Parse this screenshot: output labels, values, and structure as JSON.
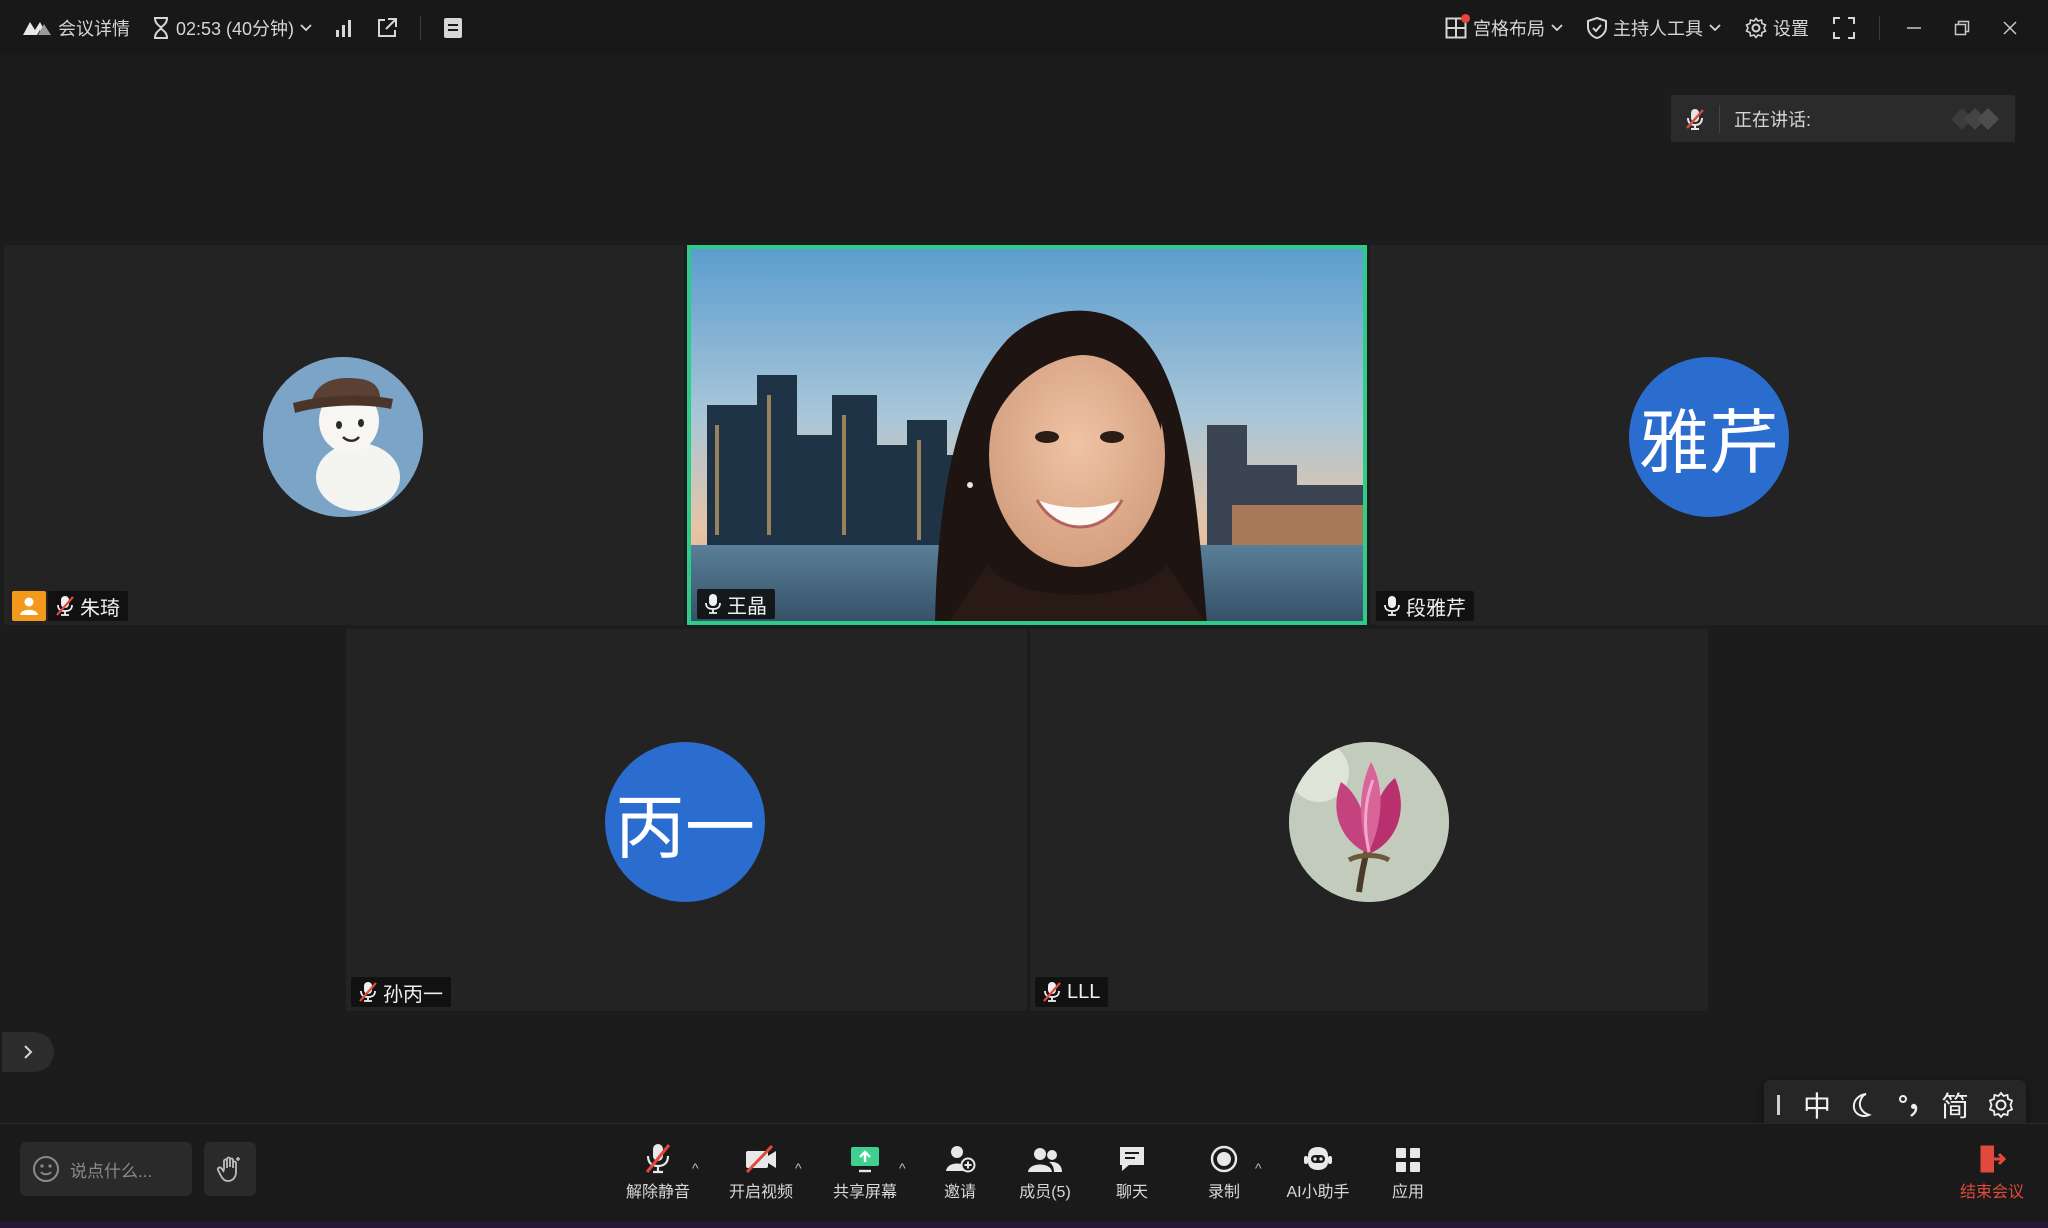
{
  "topbar": {
    "meeting_details": "会议详情",
    "timer": "02:53 (40分钟)",
    "layout": "宫格布局",
    "host_tools": "主持人工具",
    "settings": "设置"
  },
  "speaking_panel": {
    "label": "正在讲话:"
  },
  "participants": [
    {
      "name": "朱琦",
      "avatar": "snowman-avatar",
      "muted": true,
      "host": true
    },
    {
      "name": "王晶",
      "avatar": "video",
      "muted": false,
      "active_speaker": true
    },
    {
      "name": "段雅芹",
      "avatar_text": "雅芹",
      "muted": false
    },
    {
      "name": "孙丙一",
      "avatar_text": "丙一",
      "muted": true
    },
    {
      "name": "LLL",
      "avatar": "magnolia-avatar",
      "muted": true
    }
  ],
  "toolbar": {
    "chat_placeholder": "说点什么...",
    "unmute": "解除静音",
    "start_video": "开启视频",
    "share_screen": "共享屏幕",
    "invite": "邀请",
    "members": "成员(5)",
    "chat": "聊天",
    "record": "录制",
    "ai_assistant": "AI小助手",
    "apps": "应用",
    "end_meeting": "结束会议"
  },
  "ime": {
    "mode": "中",
    "script": "简"
  },
  "colors": {
    "active_border": "#2ecc87",
    "avatar_blue": "#2b6dcf",
    "end_red": "#e0493b",
    "host_orange": "#f39a1d"
  }
}
